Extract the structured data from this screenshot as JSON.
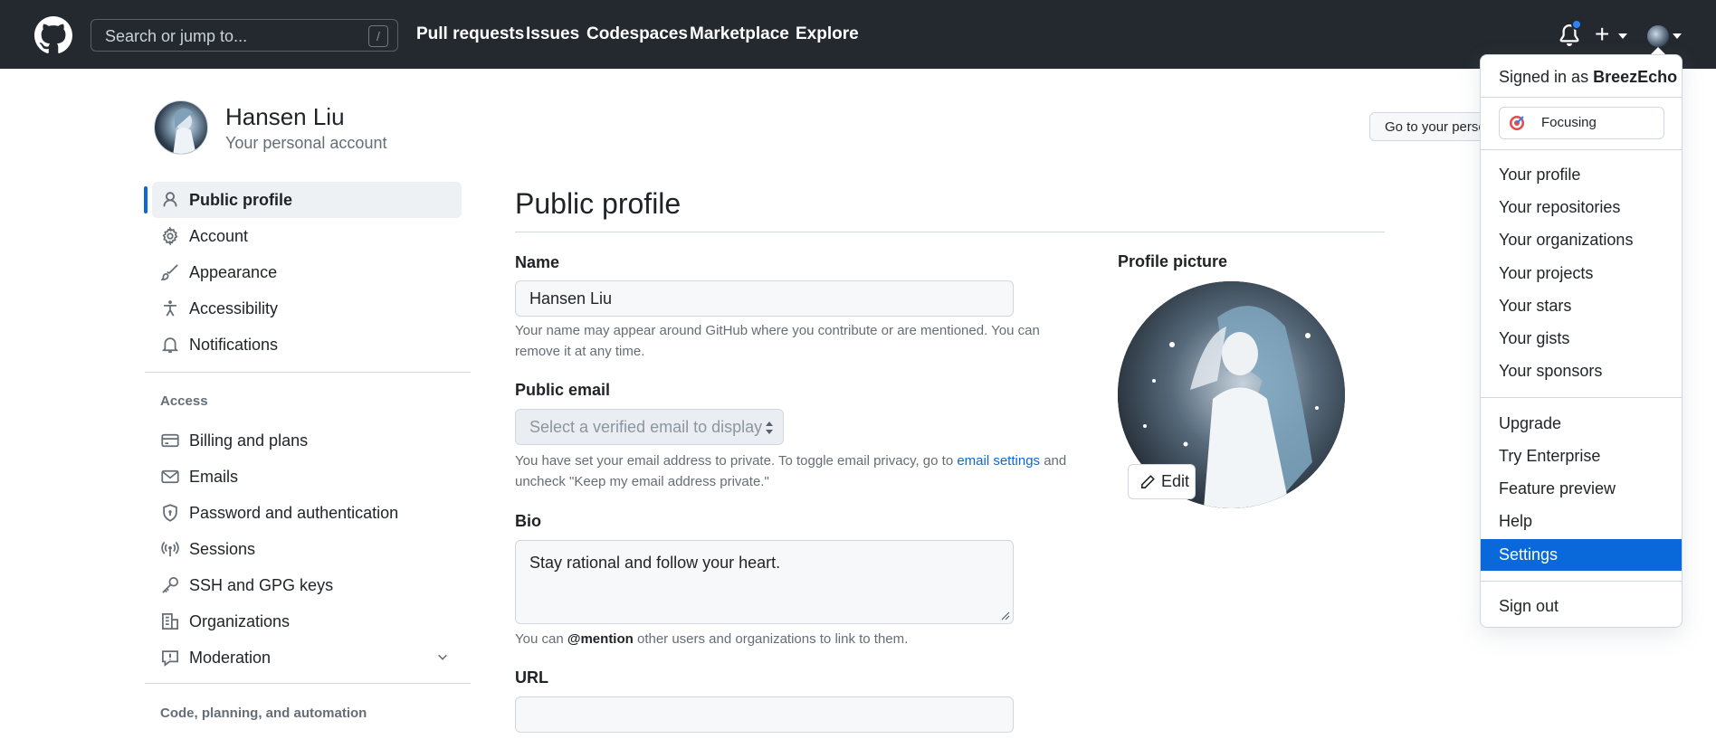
{
  "header": {
    "search_placeholder": "Search or jump to...",
    "search_shortcut": "/",
    "nav": [
      "Pull requests",
      "Issues",
      "Codespaces",
      "Marketplace",
      "Explore"
    ],
    "plus": "+"
  },
  "account": {
    "name": "Hansen Liu",
    "subtitle": "Your personal account",
    "goto_button": "Go to your personal profile"
  },
  "sidebar": {
    "items": [
      {
        "label": "Public profile",
        "icon": "person-icon",
        "active": true
      },
      {
        "label": "Account",
        "icon": "gear-icon"
      },
      {
        "label": "Appearance",
        "icon": "paintbrush-icon"
      },
      {
        "label": "Accessibility",
        "icon": "accessibility-icon"
      },
      {
        "label": "Notifications",
        "icon": "bell-icon"
      }
    ],
    "access_heading": "Access",
    "access_items": [
      {
        "label": "Billing and plans",
        "icon": "credit-card-icon"
      },
      {
        "label": "Emails",
        "icon": "mail-icon"
      },
      {
        "label": "Password and authentication",
        "icon": "shield-lock-icon"
      },
      {
        "label": "Sessions",
        "icon": "broadcast-icon"
      },
      {
        "label": "SSH and GPG keys",
        "icon": "key-icon"
      },
      {
        "label": "Organizations",
        "icon": "organization-icon"
      },
      {
        "label": "Moderation",
        "icon": "report-icon"
      }
    ],
    "code_heading": "Code, planning, and automation"
  },
  "main": {
    "title": "Public profile",
    "name_label": "Name",
    "name_value": "Hansen Liu",
    "name_note_1": "Your name may appear around GitHub where you contribute or are mentioned. You can",
    "name_note_2": "remove it at any time.",
    "email_label": "Public email",
    "email_placeholder": "Select a verified email to display",
    "email_note_1a": "You have set your email address to private. To toggle email privacy, go to ",
    "email_note_link": "email settings",
    "email_note_1b": " and",
    "email_note_2": "uncheck \"Keep my email address private.\"",
    "bio_label": "Bio",
    "bio_value": "Stay rational and follow your heart.",
    "bio_note_a": "You can ",
    "bio_note_mention": "@mention",
    "bio_note_b": " other users and organizations to link to them.",
    "url_label": "URL",
    "url_value": "",
    "picture_label": "Profile picture",
    "edit_button": "Edit"
  },
  "dropdown": {
    "signed_in_prefix": "Signed in as ",
    "username": "BreezEcho",
    "status": "Focusing",
    "group1": [
      "Your profile",
      "Your repositories",
      "Your organizations",
      "Your projects",
      "Your stars",
      "Your gists",
      "Your sponsors"
    ],
    "group2": [
      "Upgrade",
      "Try Enterprise",
      "Feature preview",
      "Help",
      "Settings"
    ],
    "selected": "Settings",
    "sign_out": "Sign out"
  },
  "colors": {
    "header_bg": "#24292f",
    "accent": "#0969da",
    "notification_dot": "#2f81f7"
  }
}
